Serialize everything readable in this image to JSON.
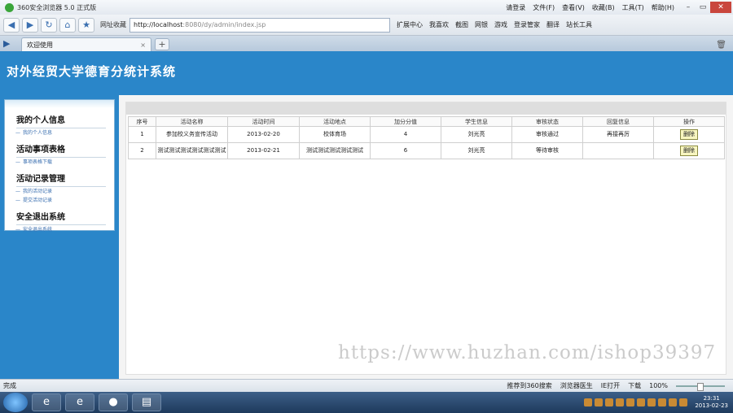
{
  "browser": {
    "title": "360安全浏览器 5.0 正式版",
    "menus": [
      "请登录",
      "文件(F)",
      "查看(V)",
      "收藏(B)",
      "工具(T)",
      "帮助(H)"
    ],
    "favorites_label": "网址收藏",
    "url_host": "http://localhost",
    "url_path": ":8080/dy/admin/index.jsp",
    "tools": [
      "扩展中心",
      "我喜欢",
      "截图",
      "网银",
      "游戏",
      "登录管家",
      "翻译",
      "站长工具"
    ],
    "tab_label": "欢迎使用"
  },
  "page": {
    "system_title": "对外经贸大学德育分统计系统",
    "sidebar": [
      {
        "title": "我的个人信息",
        "items": [
          "我的个人信息"
        ]
      },
      {
        "title": "活动事项表格",
        "items": [
          "事项表格下载"
        ]
      },
      {
        "title": "活动记录管理",
        "items": [
          "我的活动记录",
          "提交活动记录"
        ]
      },
      {
        "title": "安全退出系统",
        "items": [
          "安全退出系统"
        ]
      }
    ],
    "table": {
      "headers": [
        "序号",
        "活动名称",
        "活动时间",
        "活动地点",
        "加分分值",
        "学生信息",
        "审核状态",
        "回复信息",
        "操作"
      ],
      "rows": [
        [
          "1",
          "参加校义务宣传活动",
          "2013-02-20",
          "校体育场",
          "4",
          "刘光亮",
          "审核通过",
          "再接再厉",
          "删除"
        ],
        [
          "2",
          "测试测试测试测试测试测试",
          "2013-02-21",
          "测试测试测试测试测试",
          "6",
          "刘光亮",
          "等待审核",
          "",
          "删除"
        ]
      ]
    }
  },
  "watermark": "https://www.huzhan.com/ishop39397",
  "statusbar": {
    "left": "完成",
    "items": [
      "推荐到360搜索",
      "浏览器医生",
      "IE打开",
      "下载",
      "100%"
    ]
  },
  "taskbar": {
    "time": "23:31",
    "date": "2013-02-23"
  }
}
